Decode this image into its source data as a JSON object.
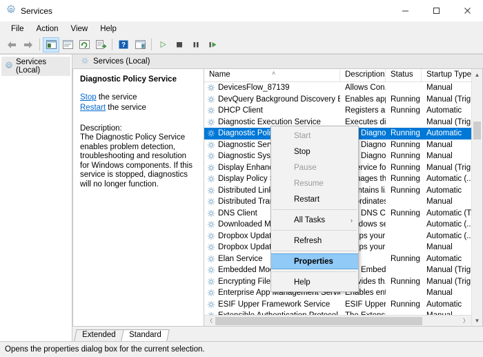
{
  "window": {
    "title": "Services",
    "icon": "services-gear-icon",
    "controls": {
      "minimize": "minimize-icon",
      "maximize": "maximize-icon",
      "close": "close-icon"
    }
  },
  "menubar": {
    "items": [
      "File",
      "Action",
      "View",
      "Help"
    ]
  },
  "toolbar": {
    "buttons": [
      {
        "name": "back-button",
        "icon": "arrow-left-icon"
      },
      {
        "name": "forward-button",
        "icon": "arrow-right-icon"
      },
      {
        "name": "show-hide-console-tree-button",
        "icon": "console-tree-icon"
      },
      {
        "name": "properties-view-button",
        "icon": "window-icon"
      },
      {
        "name": "refresh-button",
        "icon": "refresh-icon"
      },
      {
        "name": "export-list-button",
        "icon": "export-icon"
      },
      {
        "name": "help-button",
        "icon": "help-question-icon"
      },
      {
        "name": "show-action-pane-button",
        "icon": "action-pane-icon"
      },
      {
        "name": "start-service-button",
        "icon": "play-icon"
      },
      {
        "name": "stop-service-button",
        "icon": "stop-icon"
      },
      {
        "name": "pause-service-button",
        "icon": "pause-icon"
      },
      {
        "name": "restart-service-button",
        "icon": "restart-icon"
      }
    ]
  },
  "tree": {
    "root_label": "Services (Local)"
  },
  "pane": {
    "header_title": "Services (Local)"
  },
  "details": {
    "service_title": "Diagnostic Policy Service",
    "stop_link": "Stop",
    "stop_suffix": " the service",
    "restart_link": "Restart",
    "restart_suffix": " the service",
    "description_label": "Description:",
    "description_text": "The Diagnostic Policy Service enables problem detection, troubleshooting and resolution for Windows components.  If this service is stopped, diagnostics will no longer function."
  },
  "table": {
    "columns": [
      "Name",
      "Description",
      "Status",
      "Startup Type"
    ],
    "sort_column": "Name",
    "sort_caret": "˄",
    "rows": [
      {
        "name": "DevicesFlow_87139",
        "desc": "Allows Con...",
        "status": "",
        "startup": "Manual",
        "selected": false
      },
      {
        "name": "DevQuery Background Discovery B...",
        "desc": "Enables app...",
        "status": "Running",
        "startup": "Manual (Trig...",
        "selected": false
      },
      {
        "name": "DHCP Client",
        "desc": "Registers an...",
        "status": "Running",
        "startup": "Automatic",
        "selected": false
      },
      {
        "name": "Diagnostic Execution Service",
        "desc": "Executes di...",
        "status": "",
        "startup": "Manual (Trig...",
        "selected": false
      },
      {
        "name": "Diagnostic Policy Service",
        "desc": "The Diagno...",
        "status": "Running",
        "startup": "Automatic",
        "selected": true
      },
      {
        "name": "Diagnostic Service Host",
        "desc": "The Diagno...",
        "status": "Running",
        "startup": "Manual",
        "selected": false
      },
      {
        "name": "Diagnostic System Host",
        "desc": "The Diagno...",
        "status": "Running",
        "startup": "Manual",
        "selected": false
      },
      {
        "name": "Display Enhancement Service",
        "desc": "A service fo...",
        "status": "Running",
        "startup": "Manual (Trig...",
        "selected": false
      },
      {
        "name": "Display Policy Service",
        "desc": "Manages th...",
        "status": "Running",
        "startup": "Automatic (...",
        "selected": false
      },
      {
        "name": "Distributed Link Tracking Client",
        "desc": "Maintains li...",
        "status": "Running",
        "startup": "Automatic",
        "selected": false
      },
      {
        "name": "Distributed Transaction Coordina...",
        "desc": "Coordinates...",
        "status": "",
        "startup": "Manual",
        "selected": false
      },
      {
        "name": "DNS Client",
        "desc": "The DNS Cli...",
        "status": "Running",
        "startup": "Automatic (T...",
        "selected": false
      },
      {
        "name": "Downloaded Maps Manager",
        "desc": "Windows se...",
        "status": "",
        "startup": "Automatic (...",
        "selected": false
      },
      {
        "name": "Dropbox Update Service (dbupdate)",
        "desc": "Keeps your ...",
        "status": "",
        "startup": "Automatic (...",
        "selected": false
      },
      {
        "name": "Dropbox Update Service (dbupdatem)",
        "desc": "Keeps your ...",
        "status": "",
        "startup": "Manual",
        "selected": false
      },
      {
        "name": "Elan Service",
        "desc": "",
        "status": "Running",
        "startup": "Automatic",
        "selected": false
      },
      {
        "name": "Embedded Mode",
        "desc": "The Embed...",
        "status": "",
        "startup": "Manual (Trig...",
        "selected": false
      },
      {
        "name": "Encrypting File System (EFS)",
        "desc": "Provides th...",
        "status": "Running",
        "startup": "Manual (Trig...",
        "selected": false
      },
      {
        "name": "Enterprise App Management Service",
        "desc": "Enables ent...",
        "status": "",
        "startup": "Manual",
        "selected": false
      },
      {
        "name": "ESIF Upper Framework Service",
        "desc": "ESIF Upper ...",
        "status": "Running",
        "startup": "Automatic",
        "selected": false
      },
      {
        "name": "Extensible Authentication Protocol",
        "desc": "The Extensi...",
        "status": "",
        "startup": "Manual",
        "selected": false
      }
    ]
  },
  "context_menu": {
    "items": [
      {
        "label": "Start",
        "enabled": false,
        "highlighted": false,
        "submenu": false,
        "separator_after": false
      },
      {
        "label": "Stop",
        "enabled": true,
        "highlighted": false,
        "submenu": false,
        "separator_after": false
      },
      {
        "label": "Pause",
        "enabled": false,
        "highlighted": false,
        "submenu": false,
        "separator_after": false
      },
      {
        "label": "Resume",
        "enabled": false,
        "highlighted": false,
        "submenu": false,
        "separator_after": false
      },
      {
        "label": "Restart",
        "enabled": true,
        "highlighted": false,
        "submenu": false,
        "separator_after": true
      },
      {
        "label": "All Tasks",
        "enabled": true,
        "highlighted": false,
        "submenu": true,
        "separator_after": true
      },
      {
        "label": "Refresh",
        "enabled": true,
        "highlighted": false,
        "submenu": false,
        "separator_after": true
      },
      {
        "label": "Properties",
        "enabled": true,
        "highlighted": true,
        "submenu": false,
        "separator_after": true
      },
      {
        "label": "Help",
        "enabled": true,
        "highlighted": false,
        "submenu": false,
        "separator_after": false
      }
    ],
    "submenu_arrow": "›"
  },
  "tabs": [
    {
      "label": "Extended",
      "active": false
    },
    {
      "label": "Standard",
      "active": true
    }
  ],
  "statusbar": {
    "text": "Opens the properties dialog box for the current selection."
  },
  "colors": {
    "selection_blue": "#0078d7",
    "menu_highlight": "#91c9f7",
    "link_blue": "#0066cc",
    "window_bg": "#f0f0f0"
  }
}
